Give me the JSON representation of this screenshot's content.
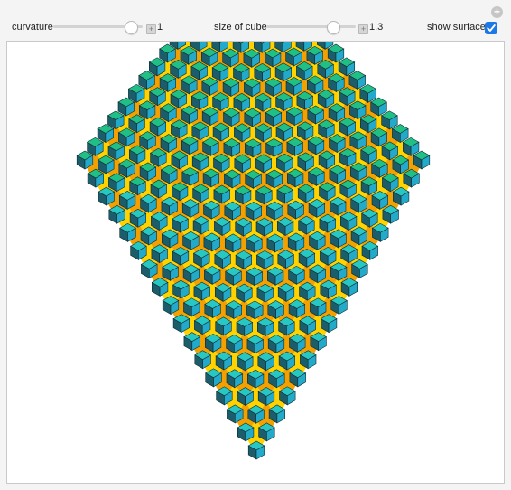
{
  "controls": {
    "curvature": {
      "label": "curvature",
      "value": "1",
      "fraction": 0.92
    },
    "cube_size": {
      "label": "size of cube",
      "value": "1.3",
      "fraction": 0.78
    },
    "surface": {
      "label": "show surface",
      "checked": true
    }
  },
  "icons": {
    "corner": "plus-circle-icon",
    "stepper": "plus-icon",
    "check": "checkmark-icon"
  },
  "colors": {
    "cube_top": "#27c8c4",
    "cube_top_alt": "#1fbf86",
    "cube_front": "#23a9c9",
    "cube_side": "#1b5d6a",
    "surface": "#f2a100",
    "surface_light": "#ffd200",
    "checkbox": "#1b78e6"
  }
}
